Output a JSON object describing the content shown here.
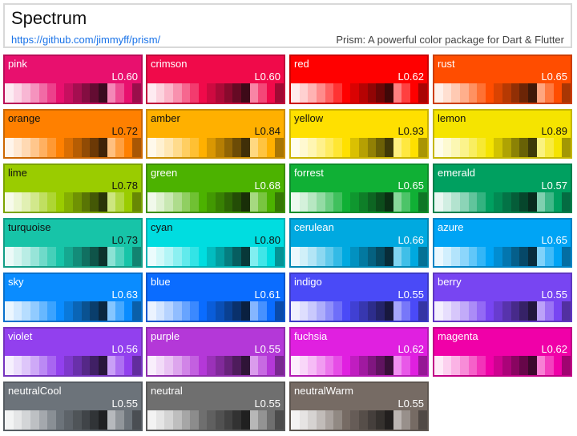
{
  "header": {
    "title": "Spectrum",
    "link": "https://github.com/jimmyff/prism/",
    "tagline": "Prism: A powerful color package for Dart & Flutter"
  },
  "palettes": [
    {
      "name": "pink",
      "lightness": "L0.60",
      "color": "#e8106e",
      "text": "light"
    },
    {
      "name": "crimson",
      "lightness": "L0.60",
      "color": "#f00a4a",
      "text": "light"
    },
    {
      "name": "red",
      "lightness": "L0.62",
      "color": "#ff0000",
      "text": "light"
    },
    {
      "name": "rust",
      "lightness": "L0.65",
      "color": "#ff4d00",
      "text": "light"
    },
    {
      "name": "orange",
      "lightness": "L0.72",
      "color": "#ff8000",
      "text": "dark"
    },
    {
      "name": "amber",
      "lightness": "L0.84",
      "color": "#ffb000",
      "text": "dark"
    },
    {
      "name": "yellow",
      "lightness": "L0.93",
      "color": "#ffe000",
      "text": "dark"
    },
    {
      "name": "lemon",
      "lightness": "L0.89",
      "color": "#f5e400",
      "text": "dark"
    },
    {
      "name": "lime",
      "lightness": "L0.78",
      "color": "#9acc00",
      "text": "dark"
    },
    {
      "name": "green",
      "lightness": "L0.68",
      "color": "#4cb200",
      "text": "light"
    },
    {
      "name": "forrest",
      "lightness": "L0.65",
      "color": "#10b035",
      "text": "light"
    },
    {
      "name": "emerald",
      "lightness": "L0.57",
      "color": "#00a060",
      "text": "light"
    },
    {
      "name": "turquoise",
      "lightness": "L0.73",
      "color": "#17c4a8",
      "text": "dark"
    },
    {
      "name": "cyan",
      "lightness": "L0.80",
      "color": "#00dde0",
      "text": "dark"
    },
    {
      "name": "cerulean",
      "lightness": "L0.66",
      "color": "#00a9e0",
      "text": "light"
    },
    {
      "name": "azure",
      "lightness": "L0.65",
      "color": "#00a4f5",
      "text": "light"
    },
    {
      "name": "sky",
      "lightness": "L0.63",
      "color": "#0a8cff",
      "text": "light"
    },
    {
      "name": "blue",
      "lightness": "L0.61",
      "color": "#0a6cff",
      "text": "light"
    },
    {
      "name": "indigo",
      "lightness": "L0.55",
      "color": "#4a4af7",
      "text": "light"
    },
    {
      "name": "berry",
      "lightness": "L0.55",
      "color": "#7845f2",
      "text": "light"
    },
    {
      "name": "violet",
      "lightness": "L0.56",
      "color": "#9240ee",
      "text": "light"
    },
    {
      "name": "purple",
      "lightness": "L0.55",
      "color": "#b438d8",
      "text": "light"
    },
    {
      "name": "fuchsia",
      "lightness": "L0.62",
      "color": "#e020e0",
      "text": "light"
    },
    {
      "name": "magenta",
      "lightness": "L0.62",
      "color": "#f000a8",
      "text": "light"
    },
    {
      "name": "neutralCool",
      "lightness": "L0.55",
      "color": "#6c737a",
      "text": "light"
    },
    {
      "name": "neutral",
      "lightness": "L0.55",
      "color": "#6f6f6f",
      "text": "light"
    },
    {
      "name": "neutralWarm",
      "lightness": "L0.55",
      "color": "#766b64",
      "text": "light"
    }
  ]
}
